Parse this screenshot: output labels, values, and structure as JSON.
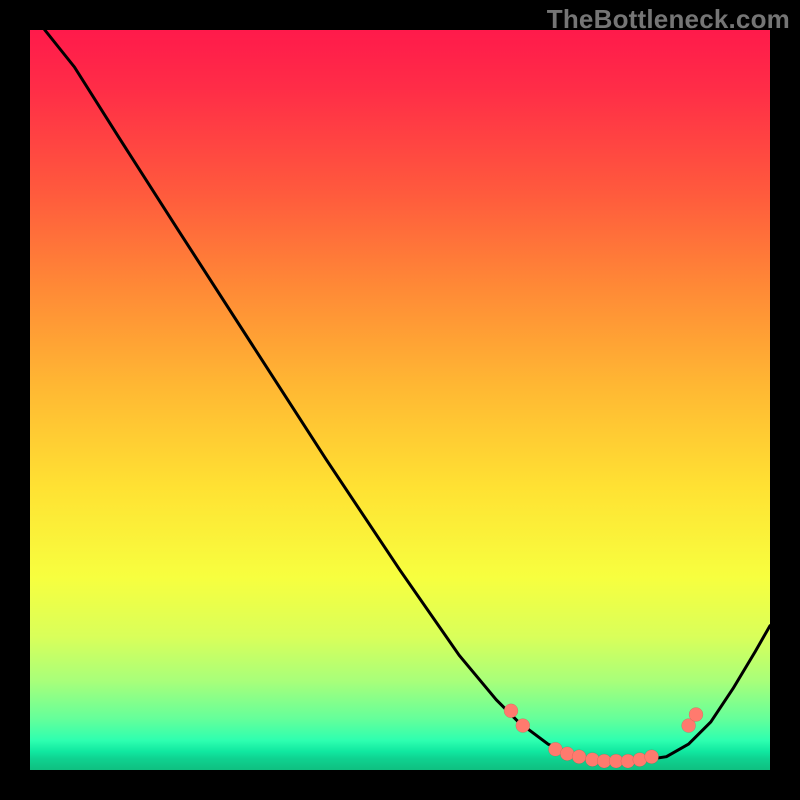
{
  "attribution": "TheBottleneck.com",
  "chart_data": {
    "type": "line",
    "title": "",
    "xlabel": "",
    "ylabel": "",
    "xlim": [
      0,
      1
    ],
    "ylim": [
      0,
      1
    ],
    "series": [
      {
        "name": "curve",
        "x": [
          0.02,
          0.04,
          0.06,
          0.12,
          0.2,
          0.3,
          0.4,
          0.5,
          0.58,
          0.63,
          0.66,
          0.7,
          0.74,
          0.78,
          0.82,
          0.86,
          0.89,
          0.92,
          0.95,
          0.98,
          1.0
        ],
        "y": [
          1.0,
          0.975,
          0.95,
          0.855,
          0.73,
          0.575,
          0.42,
          0.27,
          0.155,
          0.095,
          0.065,
          0.035,
          0.018,
          0.012,
          0.012,
          0.018,
          0.035,
          0.065,
          0.11,
          0.16,
          0.195
        ],
        "style": {
          "stroke": "#000000",
          "width": 3
        }
      }
    ],
    "markers": {
      "name": "highlight-dots",
      "color": "#ff7a6e",
      "radius_px": 7,
      "points": [
        {
          "x": 0.65,
          "y": 0.08
        },
        {
          "x": 0.666,
          "y": 0.06
        },
        {
          "x": 0.71,
          "y": 0.028
        },
        {
          "x": 0.726,
          "y": 0.022
        },
        {
          "x": 0.742,
          "y": 0.018
        },
        {
          "x": 0.76,
          "y": 0.014
        },
        {
          "x": 0.776,
          "y": 0.012
        },
        {
          "x": 0.792,
          "y": 0.012
        },
        {
          "x": 0.808,
          "y": 0.012
        },
        {
          "x": 0.824,
          "y": 0.014
        },
        {
          "x": 0.84,
          "y": 0.018
        },
        {
          "x": 0.89,
          "y": 0.06
        },
        {
          "x": 0.9,
          "y": 0.075
        }
      ]
    },
    "background_gradient": [
      {
        "stop": 0.0,
        "color": "#ff1a4b"
      },
      {
        "stop": 0.5,
        "color": "#ffd733"
      },
      {
        "stop": 0.8,
        "color": "#e0ff50"
      },
      {
        "stop": 1.0,
        "color": "#10c080"
      }
    ]
  }
}
